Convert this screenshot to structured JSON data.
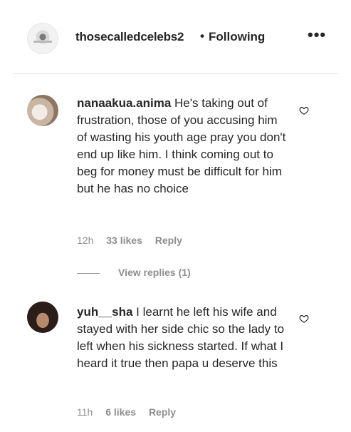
{
  "post": {
    "username": "thosecalledcelebs2",
    "separator": "•",
    "follow_status": "Following",
    "more_label": "•••"
  },
  "comments": [
    {
      "username": "nanaakua.anima",
      "text": " He's taking out of frustration, those of you accusing him of wasting his youth age pray you don't end up like him. I think coming out to beg for money must be difficult for him but he has no choice",
      "time": "12h",
      "likes": "33 likes",
      "reply_label": "Reply",
      "view_replies": "View replies (1)"
    },
    {
      "username": "yuh__sha",
      "text": " I learnt he left his wife and stayed with her side chic so the lady to left when his sickness started. If what I heard it true then papa u deserve this",
      "time": "11h",
      "likes": "6 likes",
      "reply_label": "Reply"
    }
  ],
  "icons": {
    "like": "heart-outline-icon",
    "more": "ellipsis-icon"
  },
  "colors": {
    "text": "#262626",
    "secondary": "#8e8e8e",
    "divider": "#e6e6e6"
  }
}
